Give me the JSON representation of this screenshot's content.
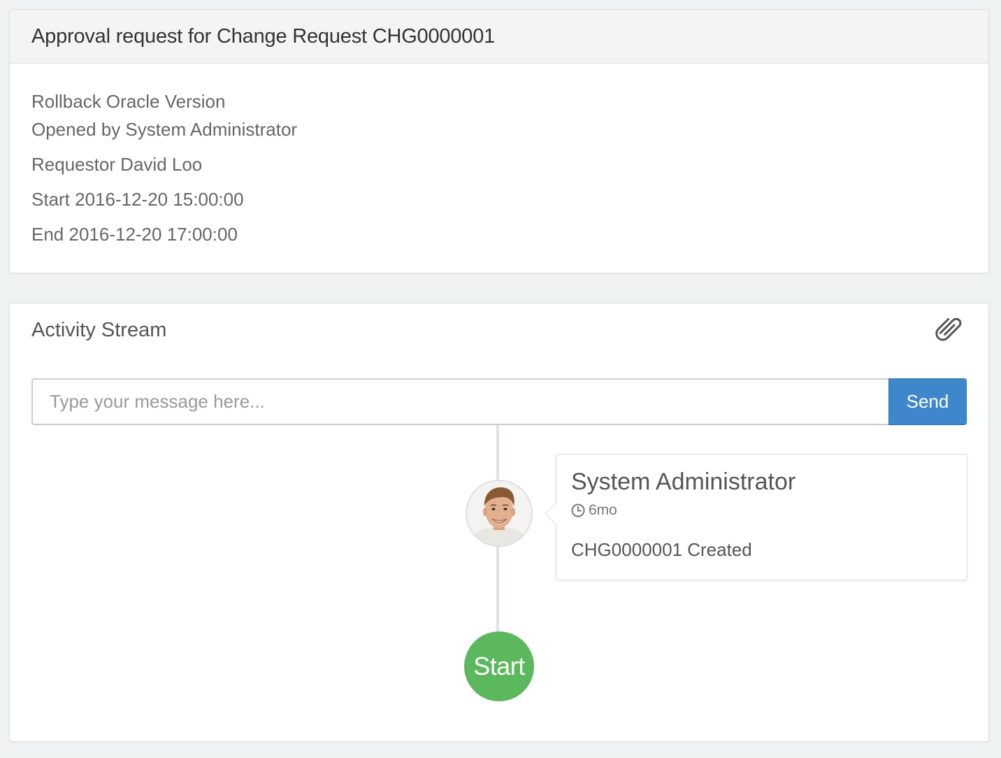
{
  "approval": {
    "title": "Approval request for Change Request CHG0000001",
    "short_description": "Rollback Oracle Version",
    "opened_by": "Opened by System Administrator",
    "requestor": "Requestor David Loo",
    "start": "Start 2016-12-20 15:00:00",
    "end": "End 2016-12-20 17:00:00"
  },
  "activity": {
    "title": "Activity Stream",
    "attach_icon": "paperclip-icon",
    "input_placeholder": "Type your message here...",
    "send_label": "Send",
    "entries": [
      {
        "author": "System Administrator",
        "time": "6mo",
        "time_icon": "clock-icon",
        "text": "CHG0000001 Created"
      }
    ],
    "start_label": "Start"
  },
  "colors": {
    "background": "#eff2f3",
    "send_button": "#3f87cc",
    "start_badge": "#5cb85c",
    "timeline": "#dde3e5"
  }
}
